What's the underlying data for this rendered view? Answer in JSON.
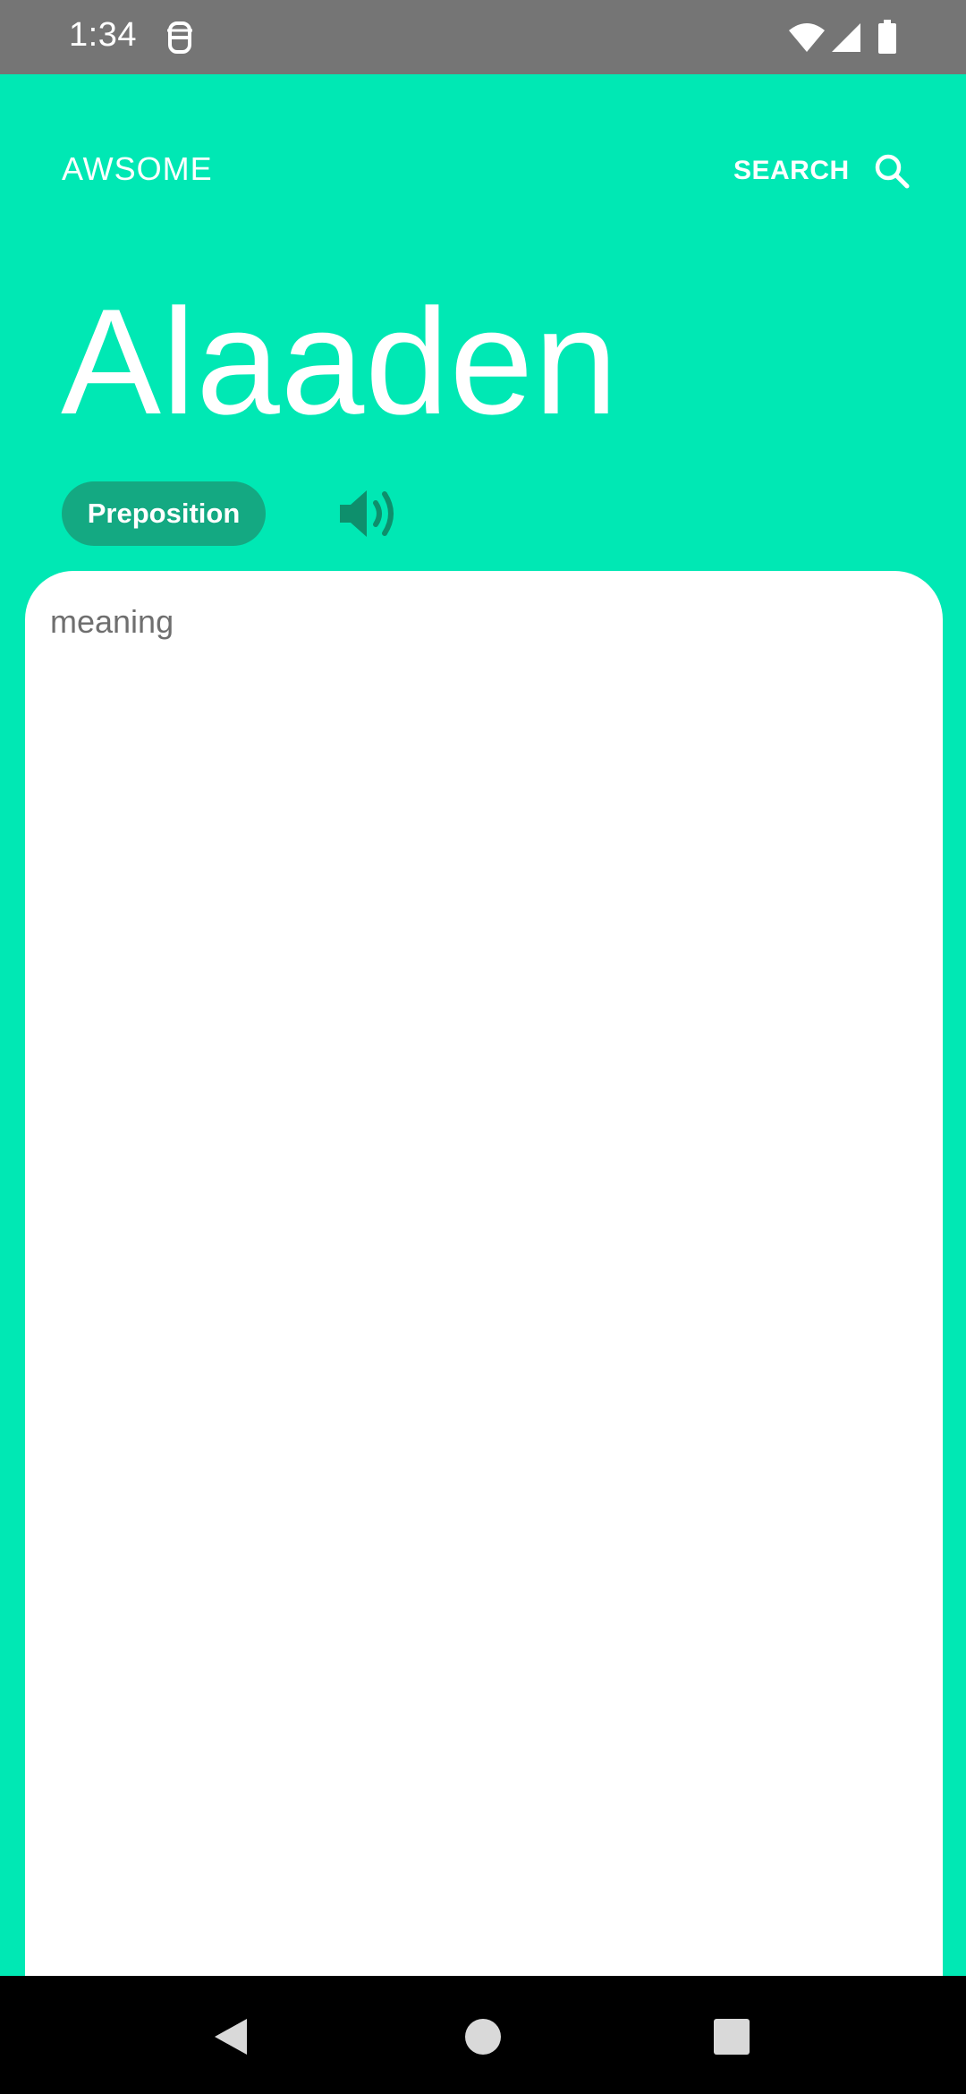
{
  "status_bar": {
    "time": "1:34",
    "app_icon": "notification-app-icon",
    "wifi_icon": "wifi-icon",
    "signal_icon": "cell-signal-icon",
    "battery_icon": "battery-icon"
  },
  "header": {
    "title": "AWSOME",
    "search_label": "SEARCH",
    "search_icon": "search-icon"
  },
  "word": {
    "text": "Alaaden",
    "part_of_speech": "Preposition",
    "speaker_icon": "speaker-icon"
  },
  "card": {
    "meaning": "meaning"
  },
  "nav_bar": {
    "back_icon": "back-icon",
    "home_icon": "home-icon",
    "recents_icon": "recents-icon"
  },
  "colors": {
    "background": "#00E8B4",
    "chip": "#14A982",
    "speaker": "#0E8F6C",
    "card": "#FFFFFF",
    "status_bar": "#757575"
  }
}
